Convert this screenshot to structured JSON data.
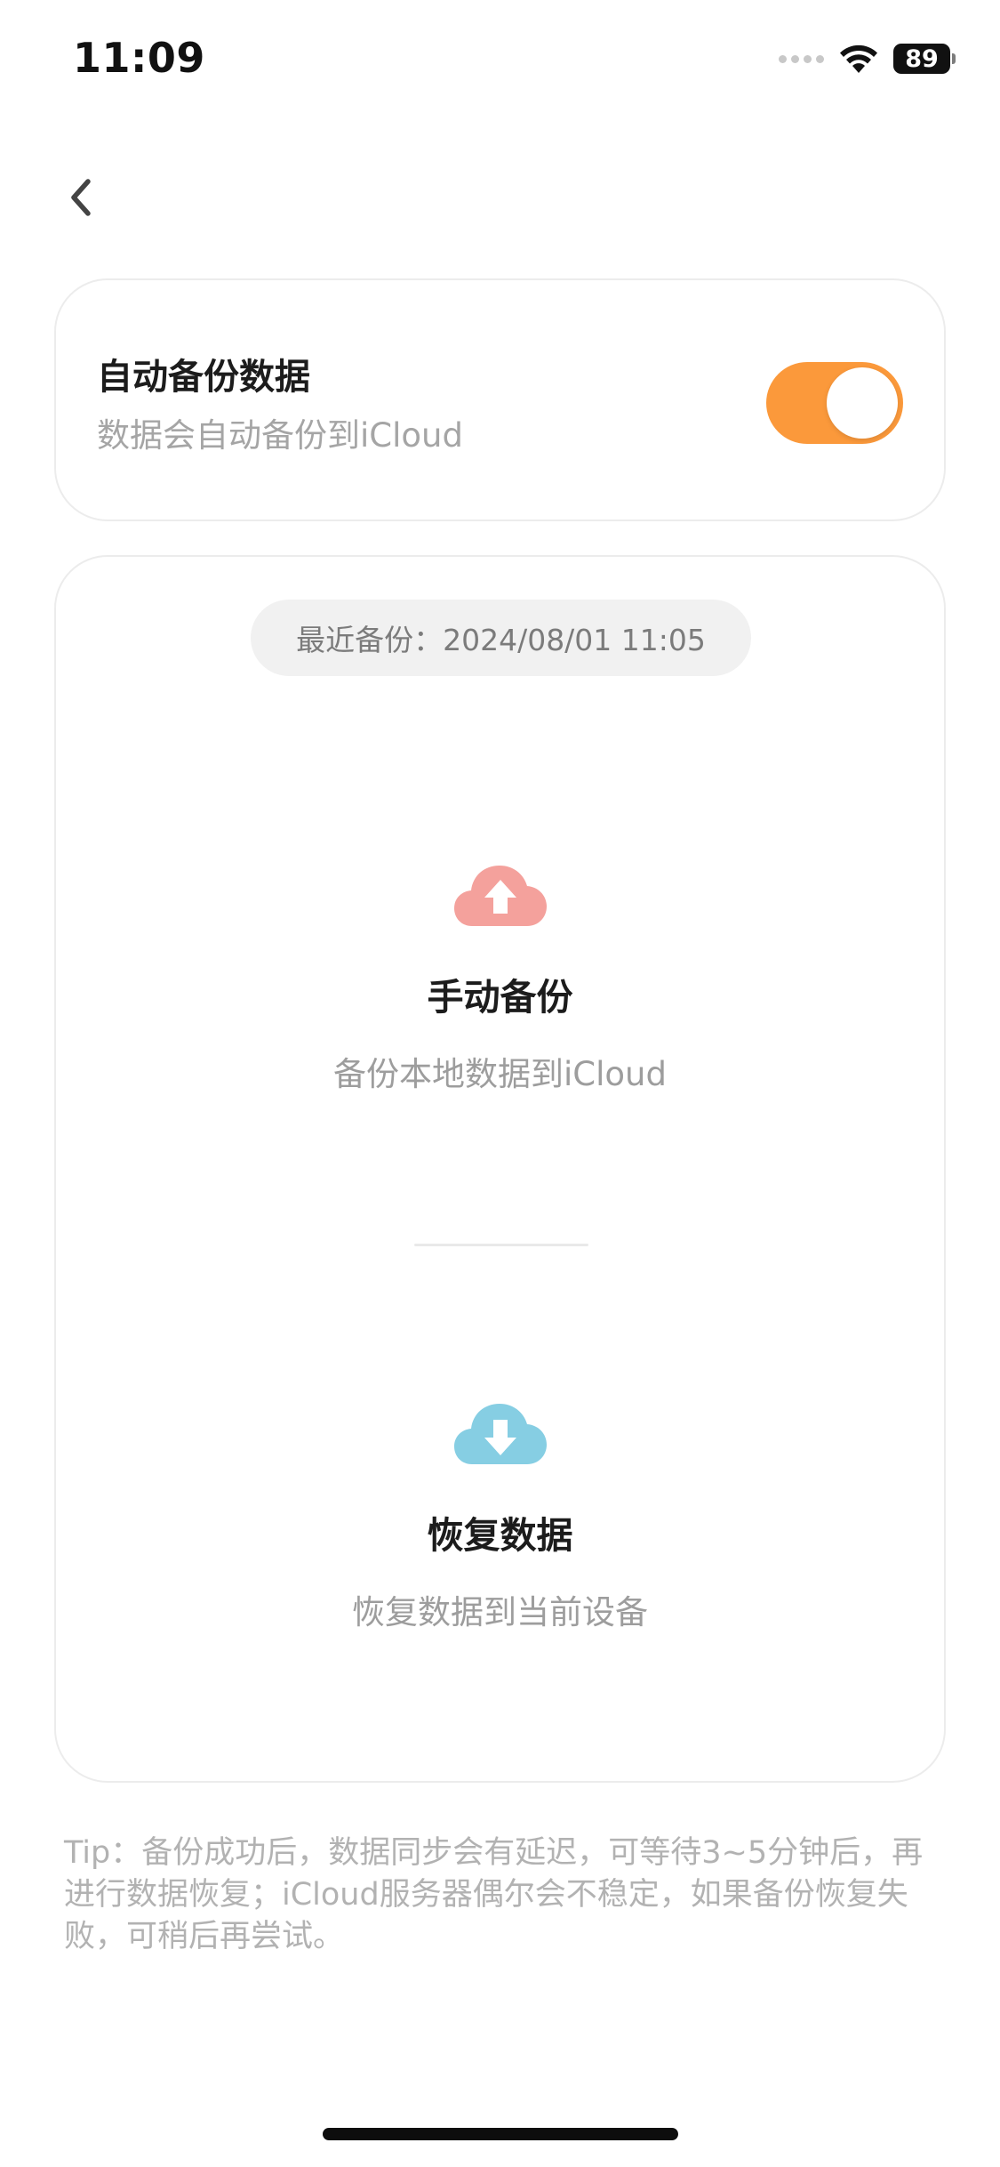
{
  "status_bar": {
    "time": "11:09",
    "battery": "89"
  },
  "header": {
    "back_icon": "chevron-left-icon"
  },
  "auto_backup": {
    "title": "自动备份数据",
    "subtitle": "数据会自动备份到iCloud",
    "enabled": true,
    "toggle_color": "#FB993B"
  },
  "backup_panel": {
    "last_backup": "最近备份：2024/08/01 11:05",
    "manual_backup": {
      "icon": "cloud-upload-icon",
      "icon_color": "#F4A19C",
      "title": "手动备份",
      "subtitle": "备份本地数据到iCloud"
    },
    "restore": {
      "icon": "cloud-download-icon",
      "icon_color": "#86CEE3",
      "title": "恢复数据",
      "subtitle": "恢复数据到当前设备"
    }
  },
  "tip": "Tip：备份成功后，数据同步会有延迟，可等待3~5分钟后，再进行数据恢复；iCloud服务器偶尔会不稳定，如果备份恢复失败，可稍后再尝试。"
}
